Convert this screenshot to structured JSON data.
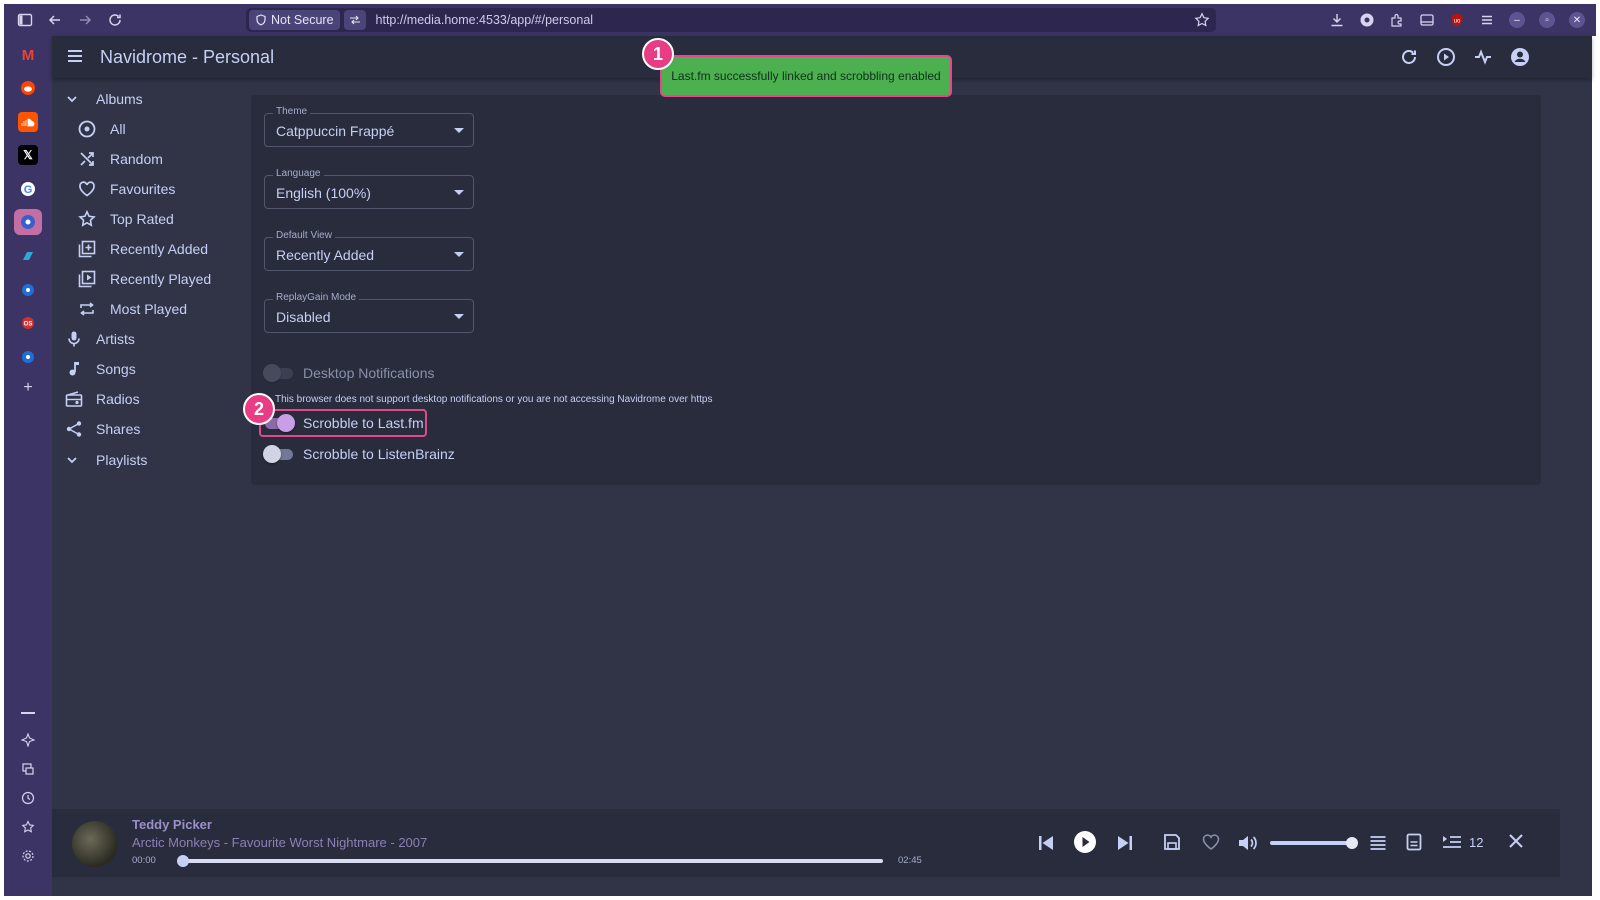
{
  "browser": {
    "security_label": "Not Secure",
    "url": "http://media.home:4533/app/#/personal"
  },
  "app": {
    "title": "Navidrome - Personal"
  },
  "nav": {
    "albums_label": "Albums",
    "album_items": [
      {
        "label": "All",
        "icon": "album-icon"
      },
      {
        "label": "Random",
        "icon": "shuffle-icon"
      },
      {
        "label": "Favourites",
        "icon": "heart-icon"
      },
      {
        "label": "Top Rated",
        "icon": "star-icon"
      },
      {
        "label": "Recently Added",
        "icon": "library-add-icon"
      },
      {
        "label": "Recently Played",
        "icon": "video-library-icon"
      },
      {
        "label": "Most Played",
        "icon": "repeat-icon"
      }
    ],
    "items": [
      {
        "label": "Artists",
        "icon": "microphone-icon"
      },
      {
        "label": "Songs",
        "icon": "music-note-icon"
      },
      {
        "label": "Radios",
        "icon": "radio-icon"
      },
      {
        "label": "Shares",
        "icon": "share-icon"
      }
    ],
    "playlists_label": "Playlists"
  },
  "settings": {
    "theme": {
      "label": "Theme",
      "value": "Catppuccin Frappé"
    },
    "language": {
      "label": "Language",
      "value": "English (100%)"
    },
    "default_view": {
      "label": "Default View",
      "value": "Recently Added"
    },
    "replaygain": {
      "label": "ReplayGain Mode",
      "value": "Disabled"
    },
    "desktop_notifications": {
      "label": "Desktop Notifications",
      "enabled": false
    },
    "notifications_helper": "This browser does not support desktop notifications or you are not accessing Navidrome over https",
    "scrobble_lastfm": {
      "label": "Scrobble to Last.fm",
      "enabled": true
    },
    "scrobble_listenbrainz": {
      "label": "Scrobble to ListenBrainz",
      "enabled": false
    }
  },
  "toast": {
    "message": "Last.fm successfully linked and scrobbling enabled"
  },
  "annotations": {
    "callout_1": "1",
    "callout_2": "2",
    "accent_color": "#e83c84"
  },
  "player": {
    "title": "Teddy Picker",
    "subtitle": "Arctic Monkeys - Favourite Worst Nightmare - 2007",
    "elapsed": "00:00",
    "duration": "02:45",
    "progress": 0.0,
    "volume": 1.0,
    "queue_count": "12"
  },
  "colors": {
    "background": "#303446",
    "surface": "#292c3c",
    "text": "#c6d0f5",
    "toast": "#4caf50",
    "switch_on": "#ca9ee6"
  }
}
